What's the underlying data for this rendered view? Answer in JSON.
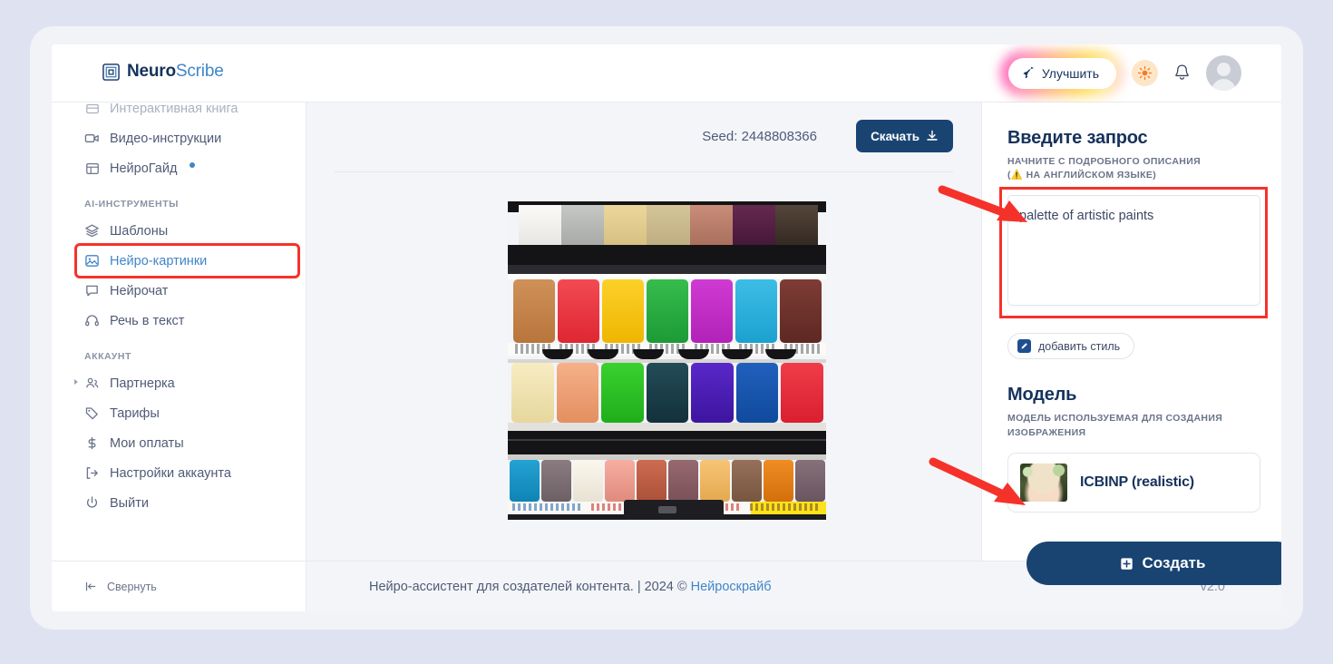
{
  "brand": {
    "name_bold": "Neuro",
    "name_light": "Scribe",
    "logo_icon": "nested-squares-icon"
  },
  "header": {
    "improve_label": "Улучшить",
    "improve_icon": "rocket-icon",
    "theme_icon": "sun-icon",
    "bell_icon": "bell-icon",
    "avatar_icon": "user-avatar-icon"
  },
  "sidebar": {
    "items_top": [
      {
        "label": "Интерактивная книга",
        "icon": "book-icon",
        "active": false,
        "cut_off": true
      },
      {
        "label": "Видео-инструкции",
        "icon": "video-camera-icon",
        "active": false
      },
      {
        "label": "НейроГайд",
        "icon": "table-grid-icon",
        "active": false,
        "dot": true
      }
    ],
    "section_tools": "AI-ИНСТРУМЕНТЫ",
    "items_tools": [
      {
        "label": "Шаблоны",
        "icon": "layers-icon",
        "active": false
      },
      {
        "label": "Нейро-картинки",
        "icon": "image-icon",
        "active": true,
        "highlighted": true
      },
      {
        "label": "Нейрочат",
        "icon": "chat-bubble-icon",
        "active": false
      },
      {
        "label": "Речь в текст",
        "icon": "headphones-icon",
        "active": false
      }
    ],
    "section_account": "АККАУНТ",
    "items_account": [
      {
        "label": "Партнерка",
        "icon": "users-icon",
        "expandable": true
      },
      {
        "label": "Тарифы",
        "icon": "tag-icon"
      },
      {
        "label": "Мои оплаты",
        "icon": "dollar-icon"
      },
      {
        "label": "Настройки аккаунта",
        "icon": "login-arrow-icon"
      },
      {
        "label": "Выйти",
        "icon": "power-icon"
      }
    ],
    "collapse_label": "Свернуть",
    "collapse_icon": "collapse-left-icon"
  },
  "main": {
    "seed_label": "Seed: 2448808366",
    "download_label": "Скачать",
    "download_icon": "download-icon",
    "image_alt": "palette of artistic paints"
  },
  "prompt": {
    "heading": "Введите запрос",
    "subtitle_line1": "НАЧНИТЕ С ПОДРОБНОГО ОПИСАНИЯ",
    "subtitle_line2": "НА АНГЛИЙСКОМ ЯЗЫКЕ)",
    "subtitle_prefix": "(",
    "warning_icon": "warning-triangle-icon",
    "value": "palette of artistic paints",
    "placeholder": "",
    "style_button_label": "добавить стиль",
    "style_button_icon": "pencil-square-icon"
  },
  "model": {
    "heading": "Модель",
    "subtitle": "МОДЕЛЬ ИСПОЛЬЗУЕМАЯ ДЛЯ СОЗДАНИЯ ИЗОБРАЖЕНИЯ",
    "selected_name": "ICBINP (realistic)",
    "thumb_icon": "model-preview-thumbnail"
  },
  "create_button": {
    "label": "Создать",
    "icon": "plus-square-icon"
  },
  "footer": {
    "text": "Нейро-ассистент для создателей контента.  | 2024 © ",
    "link": "Нейроскрайб",
    "version": "v2.0"
  },
  "annotations": {
    "arrow_1": "red-arrow-to-prompt",
    "arrow_2": "red-arrow-to-create-button",
    "box_1": "red-box-around-sidebar-item",
    "box_2": "red-box-around-prompt-input"
  },
  "colors": {
    "accent_navy": "#194472",
    "accent_blue": "#3f86c9",
    "annotation_red": "#f5322a",
    "page_bg": "#dfe3f1",
    "content_bg": "#f4f5f9"
  },
  "generated_image": {
    "row1": [
      "#f3f1ee",
      "#b9bbb9",
      "#e6d08f",
      "#cfc091",
      "#c08774",
      "#5d2347",
      "#4a3a2e"
    ],
    "row2": [
      "#c5844a",
      "#ea3b46",
      "#f6c518",
      "#2eab43",
      "#c530c8",
      "#2fb2dd",
      "#6e332e"
    ],
    "row3": [
      "#f2e2b0",
      "#f0a275",
      "#2fbe2f",
      "#1b3f4b",
      "#4b20b8",
      "#1a56b0",
      "#e8303f"
    ],
    "row4": [
      "#1e96c8",
      "#7c6e73",
      "#f6f1e6",
      "#f2a095",
      "#c1604a",
      "#8c5f68",
      "#f2bb6a",
      "#8a6550",
      "#e2801f",
      "#7a6570"
    ]
  }
}
